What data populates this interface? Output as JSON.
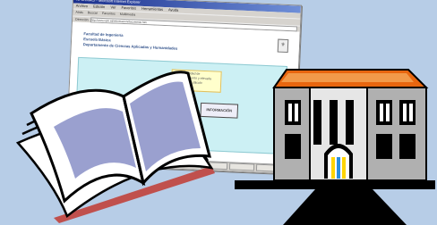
{
  "window": {
    "title": "NFORMACI - Microsoft Internet Explorer",
    "menu": [
      "Archivo",
      "Edición",
      "Ver",
      "Favoritos",
      "Herramientas",
      "Ayuda"
    ],
    "toolbar": [
      "Atrás",
      "Buscar",
      "Favoritos",
      "Multimedia"
    ],
    "address_label": "Dirección",
    "address_value": "http://www.upm.es/informacion/documento.htm"
  },
  "page": {
    "heading_lines": [
      "Facultad de Ingeniería",
      "Escuela Básica",
      "Departamento de Ciencias Aplicadas y Humanidades"
    ],
    "callout_lines": [
      "gran capacidad de",
      "almacenamiento y elevada",
      "velocidad de cálculo"
    ],
    "box_label": "INFORMACIÓN"
  },
  "colors": {
    "background": "#b7cde7",
    "book_pages": "#ffffff",
    "book_inner": "#9aa0cf",
    "book_shadow": "#c0504d",
    "building_roof": "#e8660f",
    "building_body": "#b0b0b0",
    "door_stripes": [
      "#ffd400",
      "#2a8ee0"
    ]
  },
  "icons": {
    "book": "open-book-icon",
    "building": "university-building-icon",
    "crest": "crest-icon",
    "arrow": "arrow-right-icon"
  }
}
